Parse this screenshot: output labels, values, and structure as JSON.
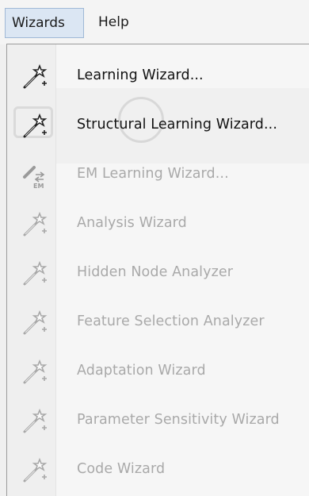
{
  "menubar": {
    "items": [
      {
        "label": "Wizards"
      },
      {
        "label": "Help"
      }
    ]
  },
  "dropdown": {
    "items": [
      {
        "label": "Learning Wizard...",
        "icon": "magic-wand-icon",
        "enabled": true
      },
      {
        "label": "Structural Learning Wizard...",
        "icon": "magic-wand-icon",
        "enabled": true
      },
      {
        "label": "EM Learning Wizard...",
        "icon": "em-learning-icon",
        "enabled": false
      },
      {
        "label": "Analysis Wizard",
        "icon": "magic-wand-icon",
        "enabled": false
      },
      {
        "label": "Hidden Node Analyzer",
        "icon": "magic-wand-icon",
        "enabled": false
      },
      {
        "label": "Feature Selection Analyzer",
        "icon": "magic-wand-icon",
        "enabled": false
      },
      {
        "label": "Adaptation Wizard",
        "icon": "magic-wand-icon",
        "enabled": false
      },
      {
        "label": "Parameter Sensitivity Wizard",
        "icon": "magic-wand-icon",
        "enabled": false
      },
      {
        "label": "Code Wizard",
        "icon": "magic-wand-icon",
        "enabled": false
      }
    ]
  },
  "colors": {
    "enabled_text": "#111111",
    "disabled_text": "#a9a9a9",
    "menubar_active_bg": "#dbe6f3",
    "menubar_active_border": "#9fb8d6"
  }
}
